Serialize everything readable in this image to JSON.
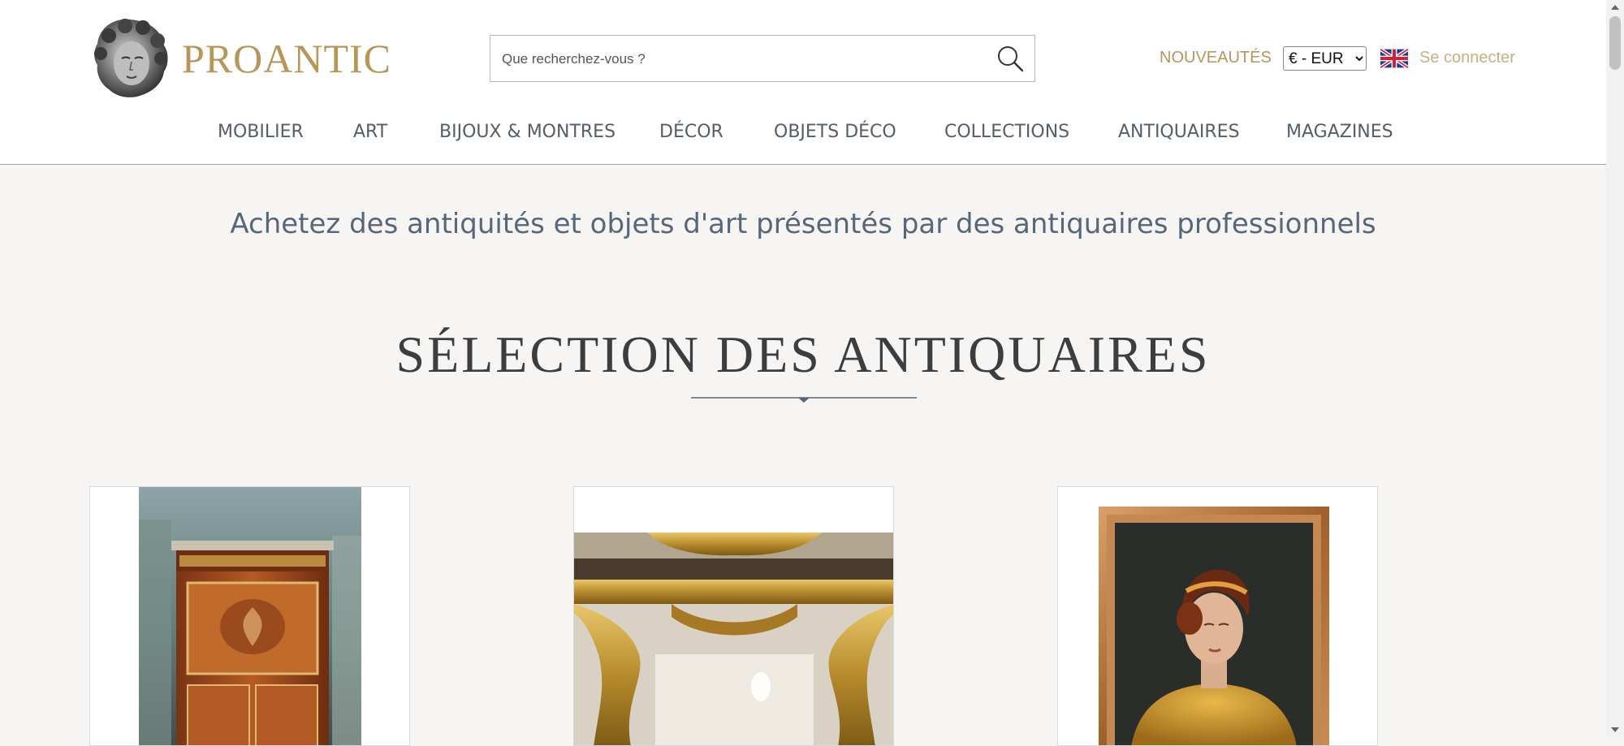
{
  "brand": {
    "name": "PROANTIC"
  },
  "search": {
    "placeholder": "Que recherchez-vous ?",
    "value": ""
  },
  "header": {
    "nouveautes_label": "NOUVEAUTÉS",
    "currency_selected": "€ - EUR",
    "language_icon": "uk-flag-icon",
    "connect_label": "Se connecter"
  },
  "nav": {
    "items": [
      {
        "label": "MOBILIER"
      },
      {
        "label": "ART"
      },
      {
        "label": "BIJOUX & MONTRES"
      },
      {
        "label": "DÉCOR"
      },
      {
        "label": "OBJETS DÉCO"
      },
      {
        "label": "COLLECTIONS"
      },
      {
        "label": "ANTIQUAIRES"
      },
      {
        "label": "MAGAZINES"
      }
    ]
  },
  "hero": {
    "tagline": "Achetez des antiquités et objets d'art présentés par des antiquaires professionnels"
  },
  "selection": {
    "title": "SÉLECTION DES ANTIQUAIRES",
    "cards": [
      {
        "image": "marquetry-secretary-cabinet"
      },
      {
        "image": "gilded-console-table"
      },
      {
        "image": "portrait-painting-woman"
      }
    ]
  },
  "colors": {
    "brand_gold": "#b89558",
    "tagline_blue": "#56677a",
    "nav_text": "#555e66",
    "page_bg": "#f6f5f3"
  }
}
